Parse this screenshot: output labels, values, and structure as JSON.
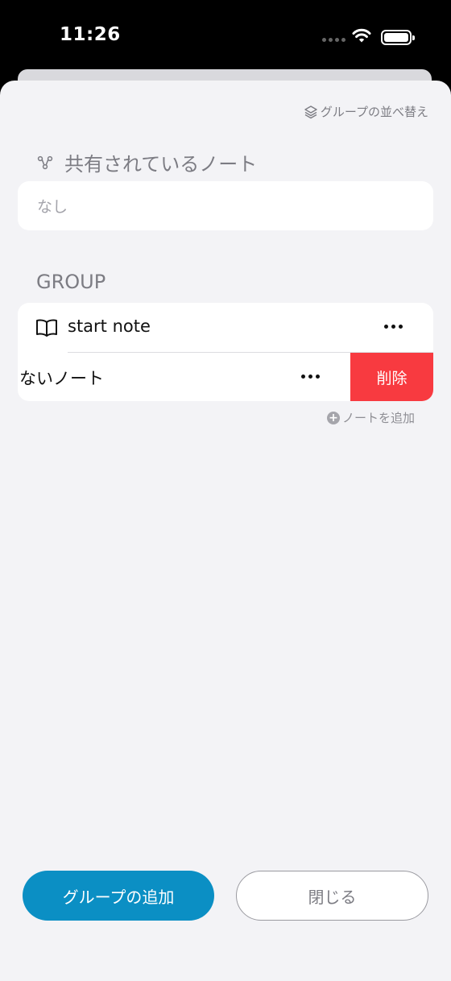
{
  "status_bar": {
    "time": "11:26"
  },
  "toolbar": {
    "sort_label": "グループの並べ替え"
  },
  "shared_section": {
    "title": "共有されているノート",
    "empty_text": "なし"
  },
  "group_section": {
    "title": "GROUP",
    "notes": [
      {
        "label": "start note"
      },
      {
        "label": "ないノート",
        "delete_label": "削除"
      }
    ],
    "add_note_label": "ノートを追加"
  },
  "buttons": {
    "add_group": "グループの追加",
    "close": "閉じる"
  },
  "colors": {
    "accent": "#0b8fc4",
    "delete": "#f83a40",
    "background": "#f3f3f6"
  }
}
